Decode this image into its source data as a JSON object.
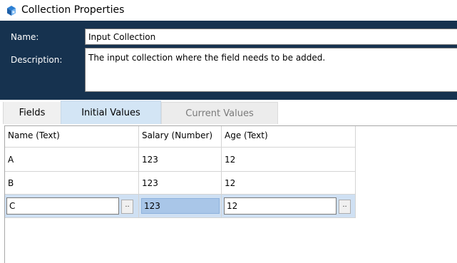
{
  "window": {
    "title": "Collection Properties",
    "icon": "collection-icon"
  },
  "properties": {
    "name_label": "Name:",
    "name_value": "Input Collection",
    "description_label": "Description:",
    "description_value": "The input collection where the field needs to be added."
  },
  "tabs": [
    {
      "label": "Fields",
      "active": false
    },
    {
      "label": "Initial Values",
      "active": true
    },
    {
      "label": "Current Values",
      "active": false
    }
  ],
  "grid": {
    "columns": [
      "Name  (Text)",
      "Salary  (Number)",
      "Age  (Text)"
    ],
    "rows": [
      [
        "A",
        "123",
        "12"
      ],
      [
        "B",
        "123",
        "12"
      ],
      [
        "C",
        "123",
        "12"
      ]
    ],
    "selected_row": 2,
    "ellipsis_label": ".."
  },
  "colors": {
    "header_bg": "#16324f",
    "active_tab_bg": "#d3e5f5",
    "selected_row_bg": "#cfe0f3",
    "selected_cell_bg": "#a9c6e8"
  }
}
